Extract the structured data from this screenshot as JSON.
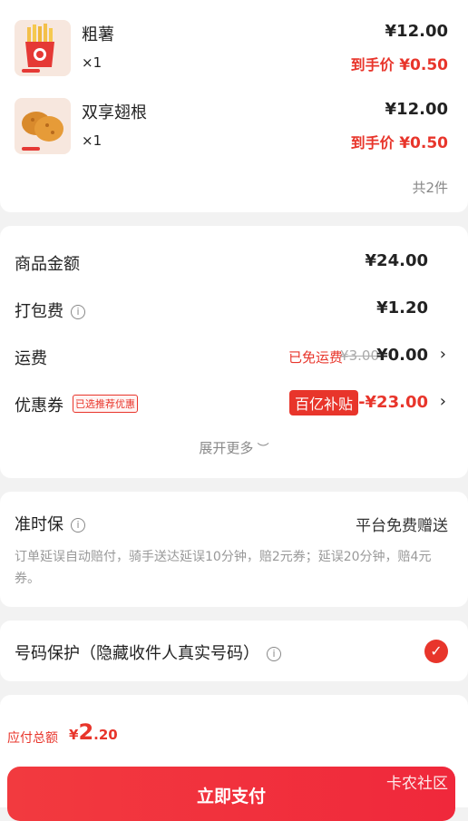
{
  "items": [
    {
      "name": "粗薯",
      "qty": "×1",
      "price": "¥12.00",
      "final_label": "到手价",
      "final_price": "¥0.50",
      "icon": "fries-icon"
    },
    {
      "name": "双享翅根",
      "qty": "×1",
      "price": "¥12.00",
      "final_label": "到手价",
      "final_price": "¥0.50",
      "icon": "chicken-wings-icon"
    }
  ],
  "item_count": "共2件",
  "fees": {
    "goods_label": "商品金额",
    "goods_value": "¥24.00",
    "packing_label": "打包费",
    "packing_value": "¥1.20",
    "shipping_label": "运费",
    "shipping_free": "已免运费",
    "shipping_original": "¥3.00",
    "shipping_value": "¥0.00",
    "coupon_label": "优惠券",
    "coupon_tag": "已选推荐优惠",
    "coupon_badge": "百亿补贴",
    "coupon_value": "-¥23.00",
    "expand": "展开更多"
  },
  "ontime": {
    "title": "准时保",
    "right": "平台免费赠送",
    "desc": "订单延误自动赔付，骑手送达延误10分钟，赔2元券；延误20分钟，赔4元券。"
  },
  "privacy": {
    "label": "号码保护（隐藏收件人真实号码）",
    "checked": true
  },
  "footer": {
    "total_label": "应付总额",
    "currency": "¥",
    "total_int": "2",
    "total_dec": ".20",
    "pay_button": "立即支付",
    "watermark": "卡农社区"
  },
  "colors": {
    "accent": "#e8352b",
    "background": "#f2f2f2"
  }
}
